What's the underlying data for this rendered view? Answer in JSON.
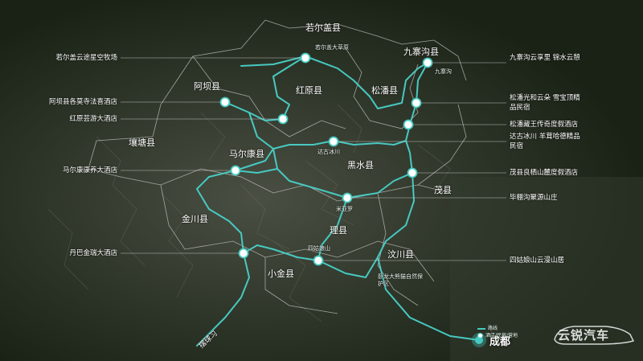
{
  "map": {
    "counties": [
      "若尔盖县",
      "九寨沟县",
      "红原县",
      "松潘县",
      "阿坝县",
      "马尔康县",
      "黑水县",
      "壤塘县",
      "茂县",
      "金川县",
      "理县",
      "汶川县",
      "小金县"
    ],
    "places": [
      "若尔盖大草原",
      "九寨沟",
      "达古冰川",
      "米亚罗",
      "四姑娘山",
      "卧龙大熊猫自然保护区"
    ],
    "city": "成都",
    "route_name": "摆球习",
    "hotels": [
      "若尔盖云途星空牧场",
      "阿坝县各莫寺法喜酒店",
      "红原芸游大酒店",
      "马尔康康养大酒店",
      "丹巴金瑞大酒店",
      "九寨沟云享里 锦水云憩",
      "松潘光和云朵 雪宝顶精品民宿",
      "松潘藏王传奇度假酒店",
      "达古冰川 羊茸哈德精品民宿",
      "茂县良栖山麓度假酒店",
      "毕棚沟聚源山庄",
      "四姑娘山云漫山居"
    ],
    "legend": [
      "路线",
      "酒店/民宿/营地"
    ],
    "watermark": "云锐汽车",
    "colors": {
      "route": "#47c9c1",
      "boundary": "#c9c9c9",
      "terrain": "#2a3224"
    }
  }
}
